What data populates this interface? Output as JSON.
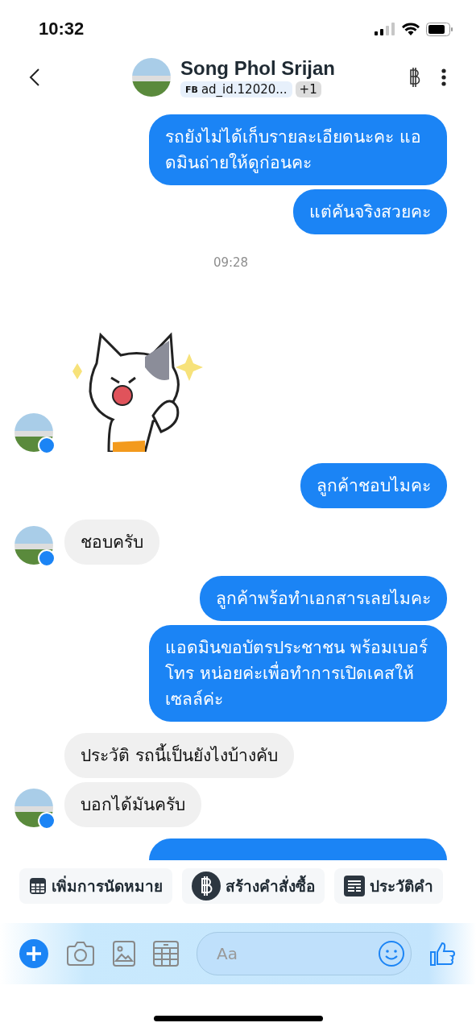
{
  "status_bar": {
    "time": "10:32"
  },
  "header": {
    "name": "Song Phol Srijan",
    "source_badge": "FB",
    "ad_id": "ad_id.12020...",
    "extra_count": "+1"
  },
  "messages": [
    {
      "kind": "out",
      "text": "รถยังไม่ได้เก็บรายละเอียดนะคะ แอดมินถ่ายให้ดูก่อนคะ"
    },
    {
      "kind": "out",
      "text": "แต่คันจริงสวยคะ"
    },
    {
      "kind": "time",
      "text": "09:28"
    },
    {
      "kind": "sticker",
      "avatar": true
    },
    {
      "kind": "out",
      "text": "ลูกค้าชอบไมคะ"
    },
    {
      "kind": "in",
      "text": "ชอบครับ",
      "avatar": true
    },
    {
      "kind": "out",
      "text": "ลูกค้าพร้อทำเอกสารเลยไมคะ"
    },
    {
      "kind": "out",
      "text": "แอดมินขอบัตรประชาชน พร้อมเบอร์โทร หน่อยค่ะเพื่อทำการเปิดเคสให้เซลล์ค่ะ"
    },
    {
      "kind": "in",
      "text": "ประวัติ รถนี้เป็นยังไงบ้างคับ",
      "avatar": false
    },
    {
      "kind": "in",
      "text": "บอกได้มันครับ",
      "avatar": true
    },
    {
      "kind": "out"
    }
  ],
  "quick_replies": [
    {
      "kind": "calendar",
      "label": "เพิ่มการนัดหมาย"
    },
    {
      "kind": "baht",
      "label": "สร้างคำสั่งซื้อ"
    },
    {
      "kind": "list",
      "label": "ประวัติคำ"
    }
  ],
  "composer": {
    "placeholder": "Aa"
  }
}
